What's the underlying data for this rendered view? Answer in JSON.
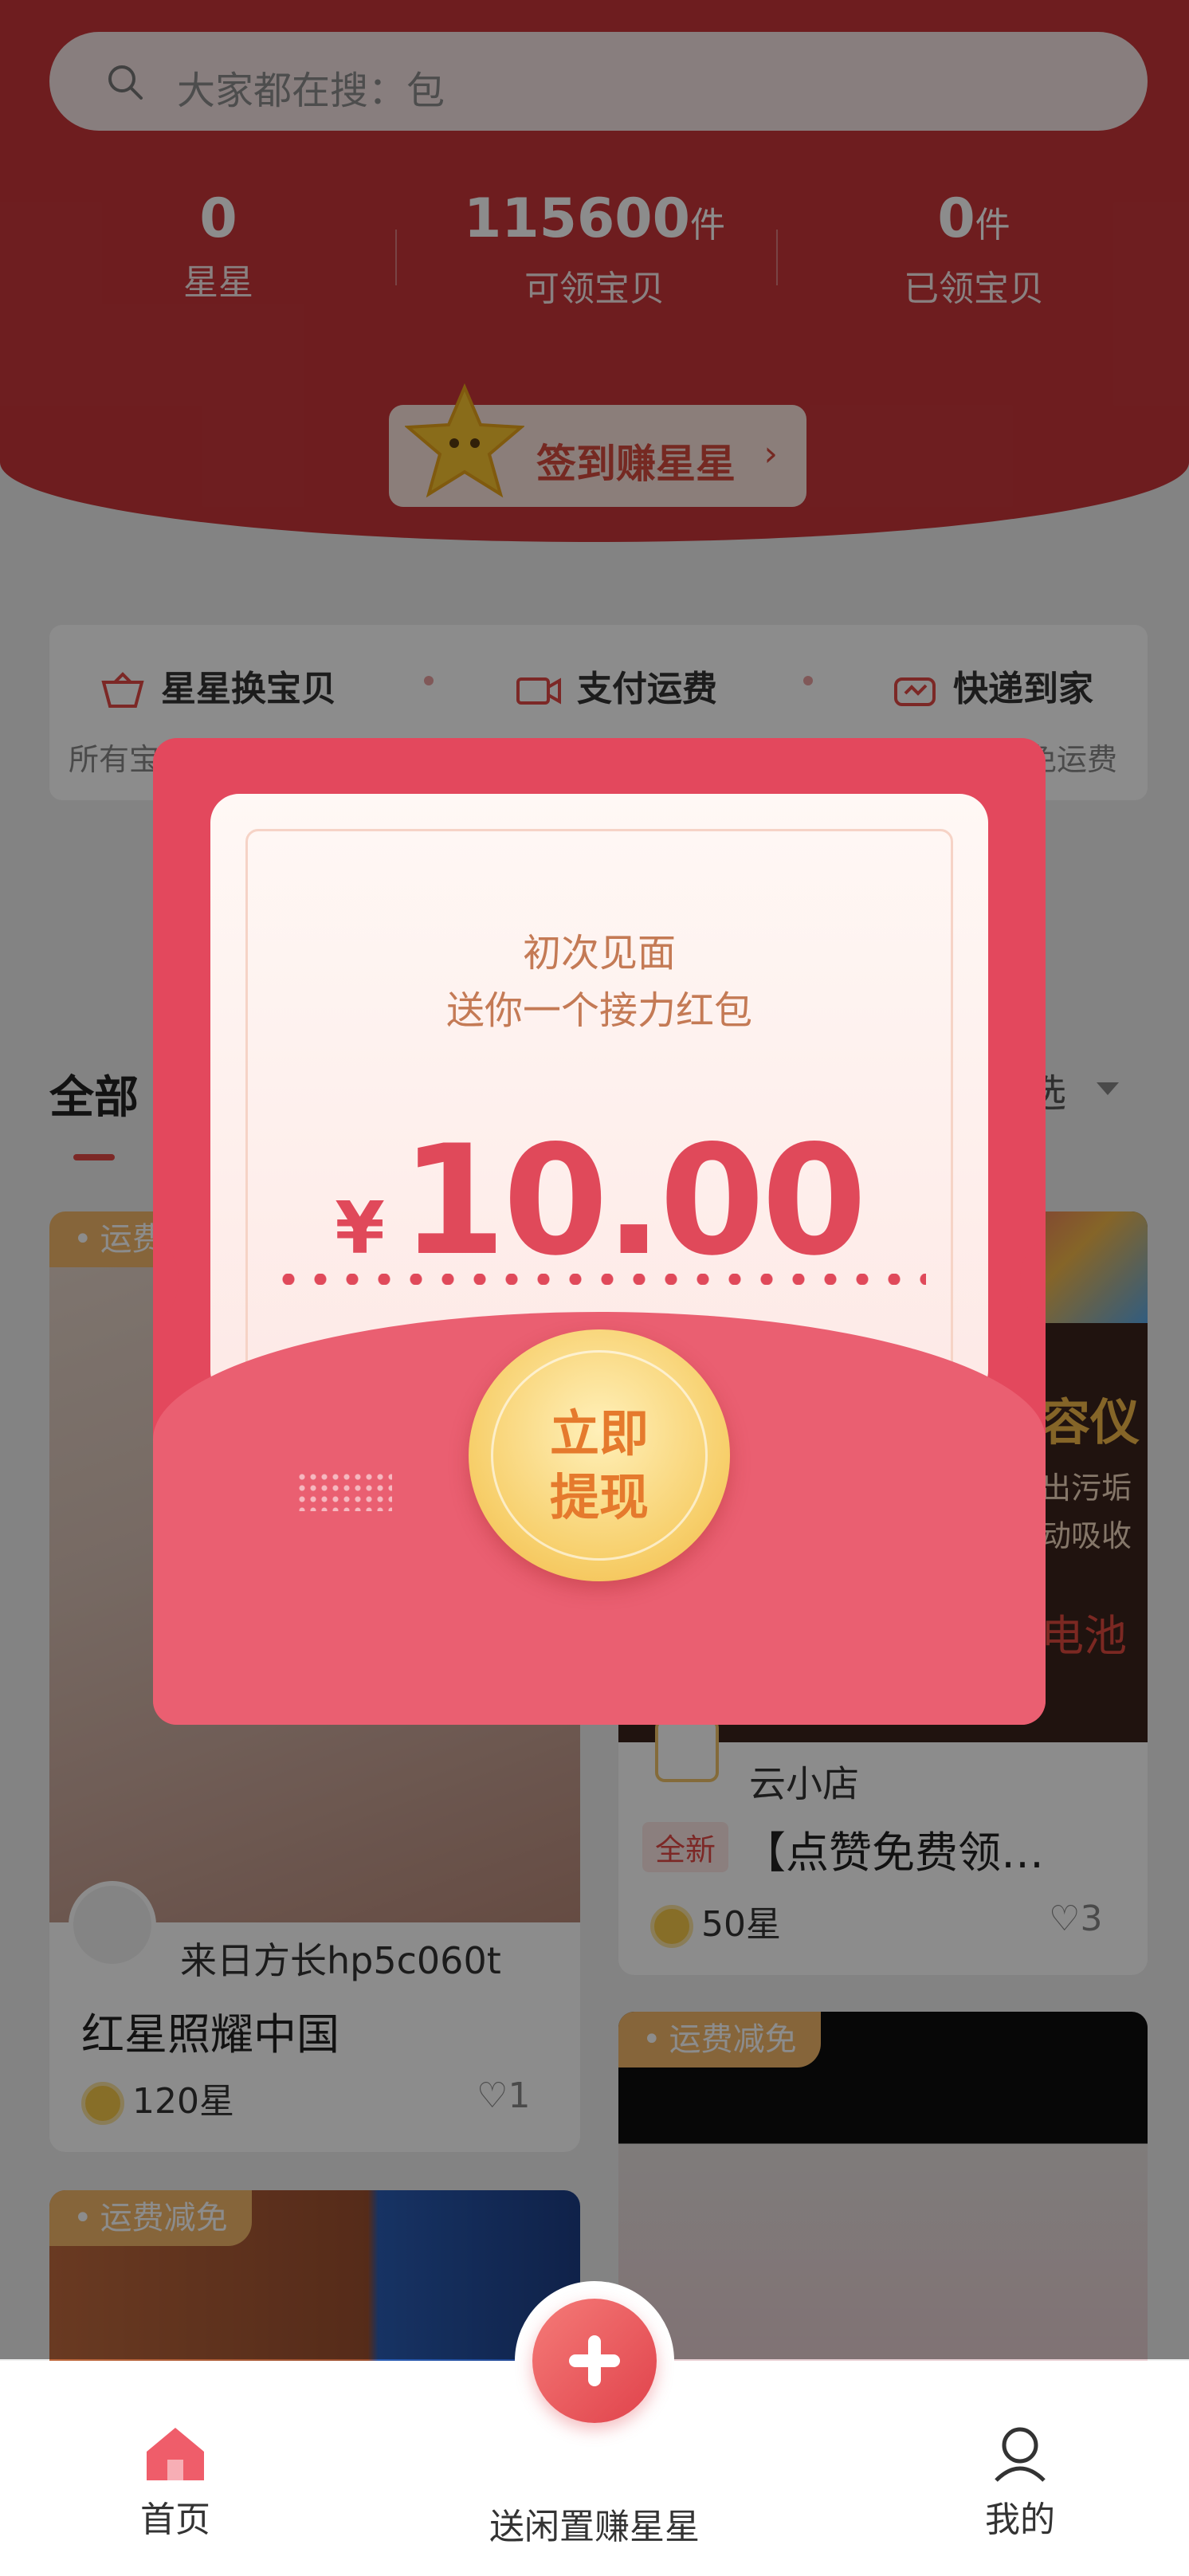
{
  "search": {
    "placeholder": "大家都在搜：包"
  },
  "stats": [
    {
      "value": "0",
      "unit": "",
      "label": "星星"
    },
    {
      "value": "115600",
      "unit": "件",
      "label": "可领宝贝"
    },
    {
      "value": "0",
      "unit": "件",
      "label": "已领宝贝"
    }
  ],
  "checkin": {
    "label": "签到赚星星",
    "arrow": "›"
  },
  "features": [
    {
      "label": "星星换宝贝",
      "sub": "所有宝"
    },
    {
      "label": "支付运费",
      "sub": ""
    },
    {
      "label": "快递到家",
      "sub": "免运费"
    }
  ],
  "tabs": {
    "all": "全部",
    "filter": "选"
  },
  "cards": [
    {
      "tag": "运费",
      "user": "来日方长hp5c060t",
      "title": "红星照耀中国",
      "stars": "120星",
      "likes": "1"
    },
    {
      "badge": "全新",
      "shop": "云小店",
      "title": "【点赞免费领…",
      "stars": "50星",
      "likes": "3",
      "ad_lines": [
        "容仪",
        "出污垢",
        "动吸收",
        "电池"
      ]
    },
    {
      "tag": "运费减免"
    },
    {
      "tag": "运费减免"
    }
  ],
  "packet": {
    "line1": "初次见面",
    "line2": "送你一个接力红包",
    "currency": "¥",
    "amount": "10.00",
    "button_line1": "立即",
    "button_line2": "提现"
  },
  "nav": {
    "home": "首页",
    "post": "送闲置赚星星",
    "mine": "我的"
  },
  "colors": {
    "brand": "#e3485d",
    "header": "#c9363a",
    "gold": "#f7cf6b"
  }
}
